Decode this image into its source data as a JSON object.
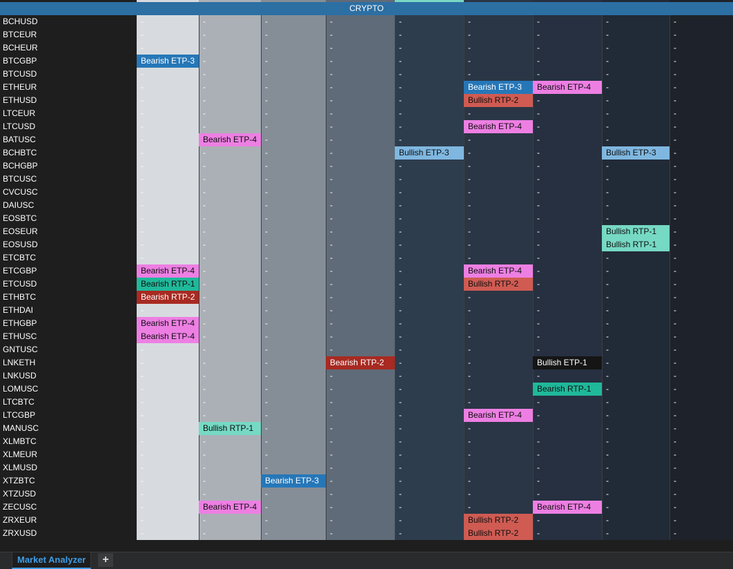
{
  "header": {
    "title": "CRYPTO"
  },
  "colors": {
    "columns": [
      "#d7dbdf",
      "#abb0b6",
      "#858e97",
      "#5f6b78",
      "#2e3d4e",
      "#2a3645",
      "#263040",
      "#212a37",
      "#1e232b"
    ],
    "top_strip": [
      "#d7dbdf",
      "#abb0b6",
      "#858e97",
      "#5f6b78",
      "#78d8c4",
      "#2a3645",
      "#263040",
      "#212a37",
      "#1e232b"
    ],
    "signals": {
      "Bearish ETP-3": "#2677b8",
      "Bearish ETP-4": "#ed7fe3",
      "Bearish RTP-1": "#20b89a",
      "Bearish RTP-2": "#a82a22",
      "Bullish ETP-1": "#151515",
      "Bullish ETP-3": "#7fb7e0",
      "Bullish RTP-1": "#76d9c4",
      "Bullish RTP-2": "#cf5b52"
    }
  },
  "rows": [
    {
      "symbol": "BCHUSD",
      "cells": [
        "-",
        "-",
        "-",
        "-",
        "-",
        "-",
        "-",
        "-",
        "-"
      ]
    },
    {
      "symbol": "BTCEUR",
      "cells": [
        "-",
        "-",
        "-",
        "-",
        "-",
        "-",
        "-",
        "-",
        "-"
      ]
    },
    {
      "symbol": "BCHEUR",
      "cells": [
        "-",
        "-",
        "-",
        "-",
        "-",
        "-",
        "-",
        "-",
        "-"
      ]
    },
    {
      "symbol": "BTCGBP",
      "cells": [
        "Bearish ETP-3",
        "-",
        "-",
        "-",
        "-",
        "-",
        "-",
        "-",
        "-"
      ]
    },
    {
      "symbol": "BTCUSD",
      "cells": [
        "-",
        "-",
        "-",
        "-",
        "-",
        "-",
        "-",
        "-",
        "-"
      ]
    },
    {
      "symbol": "ETHEUR",
      "cells": [
        "-",
        "-",
        "-",
        "-",
        "-",
        "Bearish ETP-3",
        "Bearish ETP-4",
        "-",
        "-"
      ]
    },
    {
      "symbol": "ETHUSD",
      "cells": [
        "-",
        "-",
        "-",
        "-",
        "-",
        "Bullish RTP-2",
        "-",
        "-",
        "-"
      ]
    },
    {
      "symbol": "LTCEUR",
      "cells": [
        "-",
        "-",
        "-",
        "-",
        "-",
        "-",
        "-",
        "-",
        "-"
      ]
    },
    {
      "symbol": "LTCUSD",
      "cells": [
        "-",
        "-",
        "-",
        "-",
        "-",
        "Bearish ETP-4",
        "-",
        "-",
        "-"
      ]
    },
    {
      "symbol": "BATUSC",
      "cells": [
        "-",
        "Bearish ETP-4",
        "-",
        "-",
        "-",
        "-",
        "-",
        "-",
        "-"
      ]
    },
    {
      "symbol": "BCHBTC",
      "cells": [
        "-",
        "-",
        "-",
        "-",
        "Bullish ETP-3",
        "-",
        "-",
        "Bullish ETP-3",
        "-"
      ]
    },
    {
      "symbol": "BCHGBP",
      "cells": [
        "-",
        "-",
        "-",
        "-",
        "-",
        "-",
        "-",
        "-",
        "-"
      ]
    },
    {
      "symbol": "BTCUSC",
      "cells": [
        "-",
        "-",
        "-",
        "-",
        "-",
        "-",
        "-",
        "-",
        "-"
      ]
    },
    {
      "symbol": "CVCUSC",
      "cells": [
        "-",
        "-",
        "-",
        "-",
        "-",
        "-",
        "-",
        "-",
        "-"
      ]
    },
    {
      "symbol": "DAIUSC",
      "cells": [
        "-",
        "-",
        "-",
        "-",
        "-",
        "-",
        "-",
        "-",
        "-"
      ]
    },
    {
      "symbol": "EOSBTC",
      "cells": [
        "-",
        "-",
        "-",
        "-",
        "-",
        "-",
        "-",
        "-",
        "-"
      ]
    },
    {
      "symbol": "EOSEUR",
      "cells": [
        "-",
        "-",
        "-",
        "-",
        "-",
        "-",
        "-",
        "Bullish RTP-1",
        "-"
      ]
    },
    {
      "symbol": "EOSUSD",
      "cells": [
        "-",
        "-",
        "-",
        "-",
        "-",
        "-",
        "-",
        "Bullish RTP-1",
        "-"
      ]
    },
    {
      "symbol": "ETCBTC",
      "cells": [
        "-",
        "-",
        "-",
        "-",
        "-",
        "-",
        "-",
        "-",
        "-"
      ]
    },
    {
      "symbol": "ETCGBP",
      "cells": [
        "Bearish ETP-4",
        "-",
        "-",
        "-",
        "-",
        "Bearish ETP-4",
        "-",
        "-",
        "-"
      ]
    },
    {
      "symbol": "ETCUSD",
      "cells": [
        "Bearish RTP-1",
        "-",
        "-",
        "-",
        "-",
        "Bullish RTP-2",
        "-",
        "-",
        "-"
      ]
    },
    {
      "symbol": "ETHBTC",
      "cells": [
        "Bearish RTP-2",
        "-",
        "-",
        "-",
        "-",
        "-",
        "-",
        "-",
        "-"
      ]
    },
    {
      "symbol": "ETHDAI",
      "cells": [
        "-",
        "-",
        "-",
        "-",
        "-",
        "-",
        "-",
        "-",
        "-"
      ]
    },
    {
      "symbol": "ETHGBP",
      "cells": [
        "Bearish ETP-4",
        "-",
        "-",
        "-",
        "-",
        "-",
        "-",
        "-",
        "-"
      ]
    },
    {
      "symbol": "ETHUSC",
      "cells": [
        "Bearish ETP-4",
        "-",
        "-",
        "-",
        "-",
        "-",
        "-",
        "-",
        "-"
      ]
    },
    {
      "symbol": "GNTUSC",
      "cells": [
        "-",
        "-",
        "-",
        "-",
        "-",
        "-",
        "-",
        "-",
        "-"
      ]
    },
    {
      "symbol": "LNKETH",
      "cells": [
        "-",
        "-",
        "-",
        "Bearish RTP-2",
        "-",
        "-",
        "Bullish ETP-1",
        "-",
        "-"
      ]
    },
    {
      "symbol": "LNKUSD",
      "cells": [
        "-",
        "-",
        "-",
        "-",
        "-",
        "-",
        "-",
        "-",
        "-"
      ]
    },
    {
      "symbol": "LOMUSC",
      "cells": [
        "-",
        "-",
        "-",
        "-",
        "-",
        "-",
        "Bearish RTP-1",
        "-",
        "-"
      ]
    },
    {
      "symbol": "LTCBTC",
      "cells": [
        "-",
        "-",
        "-",
        "-",
        "-",
        "-",
        "-",
        "-",
        "-"
      ]
    },
    {
      "symbol": "LTCGBP",
      "cells": [
        "-",
        "-",
        "-",
        "-",
        "-",
        "Bearish ETP-4",
        "-",
        "-",
        "-"
      ]
    },
    {
      "symbol": "MANUSC",
      "cells": [
        "-",
        "Bullish RTP-1",
        "-",
        "-",
        "-",
        "-",
        "-",
        "-",
        "-"
      ]
    },
    {
      "symbol": "XLMBTC",
      "cells": [
        "-",
        "-",
        "-",
        "-",
        "-",
        "-",
        "-",
        "-",
        "-"
      ]
    },
    {
      "symbol": "XLMEUR",
      "cells": [
        "-",
        "-",
        "-",
        "-",
        "-",
        "-",
        "-",
        "-",
        "-"
      ]
    },
    {
      "symbol": "XLMUSD",
      "cells": [
        "-",
        "-",
        "-",
        "-",
        "-",
        "-",
        "-",
        "-",
        "-"
      ]
    },
    {
      "symbol": "XTZBTC",
      "cells": [
        "-",
        "-",
        "Bearish ETP-3",
        "-",
        "-",
        "-",
        "-",
        "-",
        "-"
      ]
    },
    {
      "symbol": "XTZUSD",
      "cells": [
        "-",
        "-",
        "-",
        "-",
        "-",
        "-",
        "-",
        "-",
        "-"
      ]
    },
    {
      "symbol": "ZECUSC",
      "cells": [
        "-",
        "Bearish ETP-4",
        "-",
        "-",
        "-",
        "-",
        "Bearish ETP-4",
        "-",
        "-"
      ]
    },
    {
      "symbol": "ZRXEUR",
      "cells": [
        "-",
        "-",
        "-",
        "-",
        "-",
        "Bullish RTP-2",
        "-",
        "-",
        "-"
      ]
    },
    {
      "symbol": "ZRXUSD",
      "cells": [
        "-",
        "-",
        "-",
        "-",
        "-",
        "Bullish RTP-2",
        "-",
        "-",
        "-"
      ]
    }
  ],
  "tabs": {
    "active_label": "Market Analyzer",
    "add_icon": "plus-icon",
    "add_glyph": "+"
  }
}
